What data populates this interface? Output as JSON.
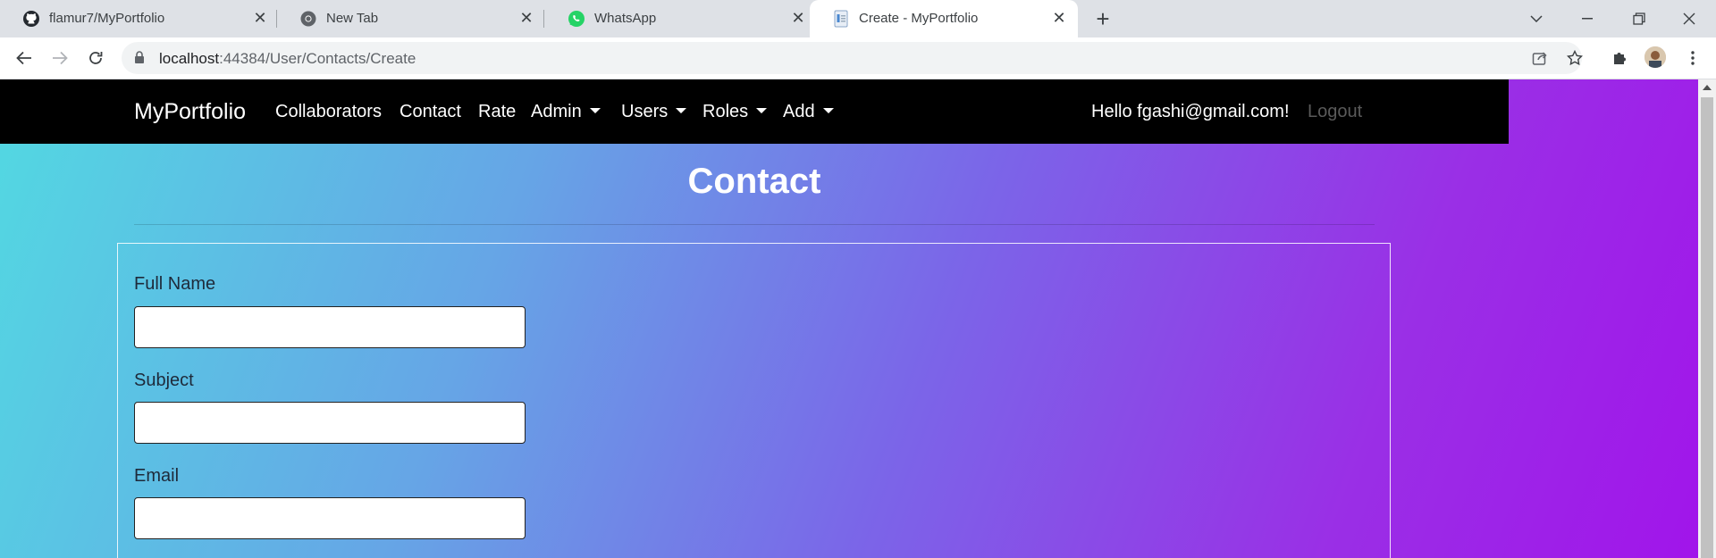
{
  "browser": {
    "tabs": [
      {
        "title": "flamur7/MyPortfolio",
        "icon": "github-icon"
      },
      {
        "title": "New Tab",
        "icon": "chrome-icon"
      },
      {
        "title": "WhatsApp",
        "icon": "whatsapp-icon"
      },
      {
        "title": "Create - MyPortfolio",
        "icon": "page-icon",
        "active": true
      }
    ],
    "url_host": "localhost",
    "url_path": ":44384/User/Contacts/Create"
  },
  "navbar": {
    "brand": "MyPortfolio",
    "links": [
      "Collaborators",
      "Contact",
      "Rate"
    ],
    "dropdowns": [
      "Admin",
      "Users",
      "Roles",
      "Add"
    ],
    "greeting": "Hello fgashi@gmail.com!",
    "logout": "Logout"
  },
  "page": {
    "title": "Contact"
  },
  "form": {
    "fields": [
      {
        "label": "Full Name",
        "value": ""
      },
      {
        "label": "Subject",
        "value": ""
      },
      {
        "label": "Email",
        "value": ""
      }
    ]
  },
  "colors": {
    "gradient_start": "#52d9e2",
    "gradient_end": "#a115ea",
    "navbar_bg": "#000000"
  }
}
